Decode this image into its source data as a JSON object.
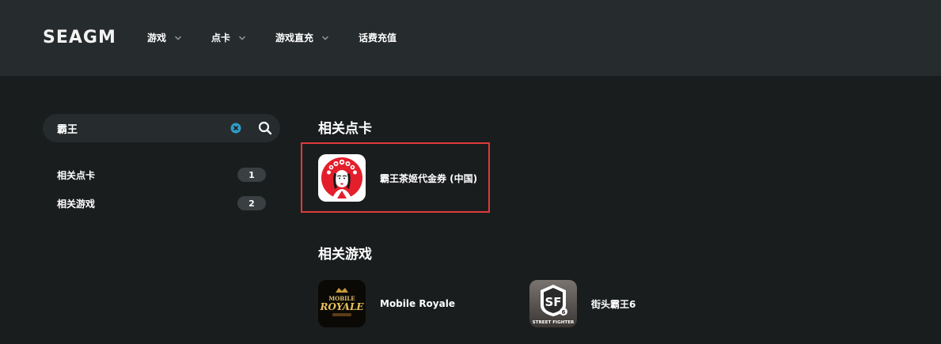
{
  "header": {
    "logo_text": "SEAGM",
    "nav": [
      {
        "label": "游戏",
        "has_dropdown": true
      },
      {
        "label": "点卡",
        "has_dropdown": true
      },
      {
        "label": "游戏直充",
        "has_dropdown": true
      },
      {
        "label": "话费充值",
        "has_dropdown": false
      }
    ]
  },
  "search": {
    "value": "霸王"
  },
  "sidebar": {
    "items": [
      {
        "label": "相关点卡",
        "count": "1"
      },
      {
        "label": "相关游戏",
        "count": "2"
      }
    ]
  },
  "main": {
    "cards_section": {
      "title": "相关点卡",
      "items": [
        {
          "name": "霸王茶姬代金券 (中国)",
          "icon": "bawang-chaji-icon"
        }
      ]
    },
    "games_section": {
      "title": "相关游戏",
      "items": [
        {
          "name": "Mobile Royale",
          "icon": "mobile-royale-icon",
          "logo_line1": "MOBILE",
          "logo_line2": "ROYALE"
        },
        {
          "name": "街头霸王6",
          "icon": "street-fighter-6-icon",
          "logo_caption": "STREET FIGHTER"
        }
      ]
    }
  },
  "colors": {
    "header_bg": "#262b2d",
    "page_bg": "#1a1d1e",
    "highlight": "#e03a3a",
    "badge_bg": "#3a3f42",
    "clear_icon": "#2f9bc4"
  }
}
